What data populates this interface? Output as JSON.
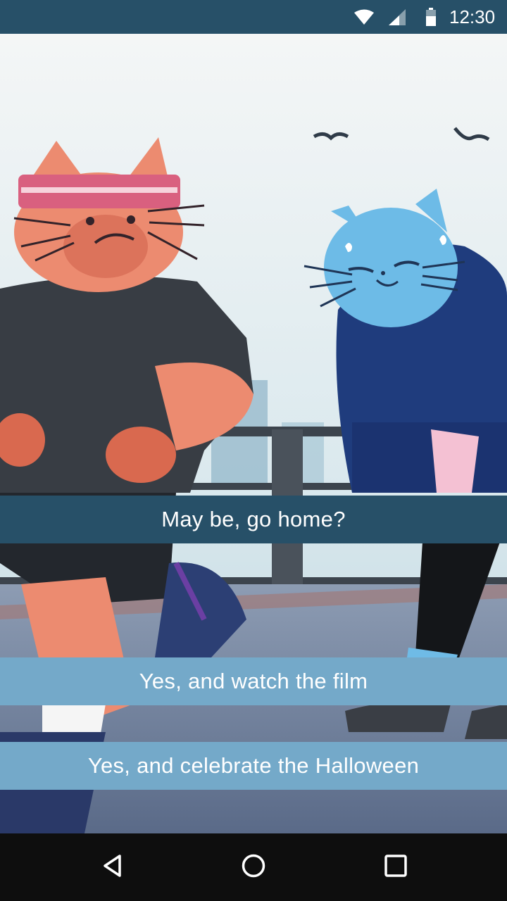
{
  "status_bar": {
    "time": "12:30",
    "icons": [
      "wifi-icon",
      "cell-signal-icon",
      "battery-icon"
    ],
    "background": "#275068"
  },
  "illustration": {
    "description_icon": "jogging-cats-illustration"
  },
  "choices": [
    {
      "label": "May be, go home?",
      "background": "#275068"
    },
    {
      "label": "Yes, and watch the film",
      "background": "#74a9c9"
    },
    {
      "label": "Yes, and celebrate the Halloween",
      "background": "#74a9c9"
    }
  ],
  "nav_bar": {
    "icons": [
      "back-icon",
      "home-icon",
      "recent-apps-icon"
    ],
    "background": "#0e0e0e"
  }
}
